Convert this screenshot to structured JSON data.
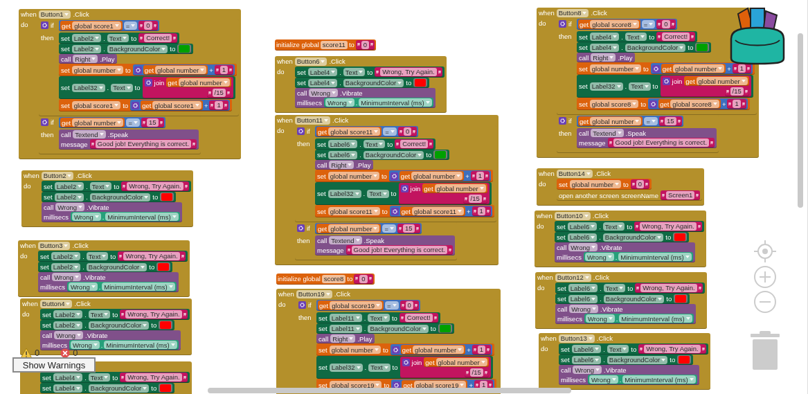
{
  "workspace": {
    "blocks": [
      {
        "kind": "event",
        "when": "when",
        "component": "Button1",
        "event": ".Click",
        "do": "do",
        "body": [
          {
            "kind": "if",
            "label": "if",
            "cond": {
              "kind": "compare",
              "left": {
                "kind": "get",
                "label": "get",
                "field": "global score1"
              },
              "op": "=",
              "right": {
                "kind": "text",
                "string": "0"
              }
            },
            "then": "then",
            "body": [
              {
                "kind": "set_prop",
                "label": "set",
                "component": "Label2",
                "dot": ".",
                "property": "Text",
                "to": "to",
                "value": {
                  "kind": "text",
                  "string": "Correct!"
                }
              },
              {
                "kind": "set_prop",
                "label": "set",
                "component": "Label2",
                "dot": ".",
                "property": "BackgroundColor",
                "to": "to",
                "value": {
                  "kind": "color",
                  "color": "#00a000"
                }
              },
              {
                "kind": "call",
                "label": "call",
                "component": "Right",
                "method": ".Play"
              },
              {
                "kind": "set_var",
                "label": "set",
                "field": "global number",
                "to": "to",
                "value": {
                  "kind": "add",
                  "left": {
                    "kind": "get",
                    "label": "get",
                    "field": "global number"
                  },
                  "op": "+",
                  "right": {
                    "kind": "text",
                    "string": "1"
                  }
                }
              },
              {
                "kind": "set_prop",
                "label": "set",
                "component": "Label32",
                "dot": ".",
                "property": "Text",
                "to": "to",
                "value": {
                  "kind": "join",
                  "label": "join",
                  "items": [
                    {
                      "kind": "get",
                      "label": "get",
                      "field": "global number"
                    },
                    {
                      "kind": "text",
                      "string": "/15"
                    }
                  ]
                }
              },
              {
                "kind": "set_var",
                "label": "set",
                "field": "global score1",
                "to": "to",
                "value": {
                  "kind": "add",
                  "left": {
                    "kind": "get",
                    "label": "get",
                    "field": "global score1"
                  },
                  "op": "+",
                  "right": {
                    "kind": "text",
                    "string": "1"
                  }
                }
              }
            ]
          },
          {
            "kind": "if",
            "label": "if",
            "cond": {
              "kind": "compare",
              "left": {
                "kind": "get",
                "label": "get",
                "field": "global number"
              },
              "op": "=",
              "right": {
                "kind": "text",
                "string": "15"
              }
            },
            "then": "then",
            "body": [
              {
                "kind": "call",
                "label": "call",
                "component": "Textend",
                "method": ".Speak",
                "args": [
                  {
                    "name": "message",
                    "value": {
                      "kind": "text",
                      "string": "Good job! Everything is correct."
                    }
                  }
                ]
              }
            ]
          }
        ]
      },
      {
        "kind": "event",
        "when": "when",
        "component": "Button2",
        "event": ".Click",
        "do": "do",
        "body": [
          {
            "kind": "set_prop",
            "label": "set",
            "component": "Label2",
            "dot": ".",
            "property": "Text",
            "to": "to",
            "value": {
              "kind": "text",
              "string": "Wrong, Try Again."
            }
          },
          {
            "kind": "set_prop",
            "label": "set",
            "component": "Label2",
            "dot": ".",
            "property": "BackgroundColor",
            "to": "to",
            "value": {
              "kind": "color",
              "color": "#ff0000"
            }
          },
          {
            "kind": "call",
            "label": "call",
            "component": "Wrong",
            "method": ".Vibrate",
            "args": [
              {
                "name": "millisecs",
                "value": {
                  "kind": "property",
                  "component": "Wrong",
                  "dot": ".",
                  "property": "MinimumInterval (ms)"
                }
              }
            ]
          }
        ]
      },
      {
        "kind": "event",
        "when": "when",
        "component": "Button3",
        "event": ".Click",
        "do": "do",
        "body": [
          {
            "kind": "set_prop",
            "label": "set",
            "component": "Label2",
            "dot": ".",
            "property": "Text",
            "to": "to",
            "value": {
              "kind": "text",
              "string": "Wrong, Try Again."
            }
          },
          {
            "kind": "set_prop",
            "label": "set",
            "component": "Label2",
            "dot": ".",
            "property": "BackgroundColor",
            "to": "to",
            "value": {
              "kind": "color",
              "color": "#ff0000"
            }
          },
          {
            "kind": "call",
            "label": "call",
            "component": "Wrong",
            "method": ".Vibrate",
            "args": [
              {
                "name": "millisecs",
                "value": {
                  "kind": "property",
                  "component": "Wrong",
                  "dot": ".",
                  "property": "MinimumInterval (ms)"
                }
              }
            ]
          }
        ]
      },
      {
        "kind": "event",
        "when": "when",
        "component": "Button4",
        "event": ".Click",
        "do": "do",
        "body": [
          {
            "kind": "set_prop",
            "label": "set",
            "component": "Label2",
            "dot": ".",
            "property": "Text",
            "to": "to",
            "value": {
              "kind": "text",
              "string": "Wrong, Try Again."
            }
          },
          {
            "kind": "set_prop",
            "label": "set",
            "component": "Label2",
            "dot": ".",
            "property": "BackgroundColor",
            "to": "to",
            "value": {
              "kind": "color",
              "color": "#ff0000"
            }
          },
          {
            "kind": "call",
            "label": "call",
            "component": "Wrong",
            "method": ".Vibrate",
            "args": [
              {
                "name": "millisecs",
                "value": {
                  "kind": "property",
                  "component": "Wrong",
                  "dot": ".",
                  "property": "MinimumInterval (ms)"
                }
              }
            ]
          }
        ]
      },
      {
        "kind": "event",
        "body": [
          {
            "kind": "set_prop",
            "label": "set",
            "component": "Label4",
            "dot": ".",
            "property": "Text",
            "to": "to",
            "value": {
              "kind": "text",
              "string": "Wrong, Try Again."
            }
          },
          {
            "kind": "set_prop",
            "label": "set",
            "component": "Label4",
            "dot": ".",
            "property": "BackgroundColor",
            "to": "to",
            "value": {
              "kind": "color",
              "color": "#ff0000"
            }
          }
        ]
      },
      {
        "kind": "init",
        "label": "initialize global",
        "name": "score11",
        "to": "to",
        "value": {
          "kind": "text",
          "string": "0"
        }
      },
      {
        "kind": "event",
        "when": "when",
        "component": "Button6",
        "event": ".Click",
        "do": "do",
        "body": [
          {
            "kind": "set_prop",
            "label": "set",
            "component": "Label4",
            "dot": ".",
            "property": "Text",
            "to": "to",
            "value": {
              "kind": "text",
              "string": "Wrong, Try Again."
            }
          },
          {
            "kind": "set_prop",
            "label": "set",
            "component": "Label4",
            "dot": ".",
            "property": "BackgroundColor",
            "to": "to",
            "value": {
              "kind": "color",
              "color": "#ff0000"
            }
          },
          {
            "kind": "call",
            "label": "call",
            "component": "Wrong",
            "method": ".Vibrate",
            "args": [
              {
                "name": "millisecs",
                "value": {
                  "kind": "property",
                  "component": "Wrong",
                  "dot": ".",
                  "property": "MinimumInterval (ms)"
                }
              }
            ]
          }
        ]
      },
      {
        "kind": "event",
        "when": "when",
        "component": "Button11",
        "event": ".Click",
        "do": "do",
        "body": [
          {
            "kind": "if",
            "label": "if",
            "cond": {
              "kind": "compare",
              "left": {
                "kind": "get",
                "label": "get",
                "field": "global score11"
              },
              "op": "=",
              "right": {
                "kind": "text",
                "string": "0"
              }
            },
            "then": "then",
            "body": [
              {
                "kind": "set_prop",
                "label": "set",
                "component": "Label6",
                "dot": ".",
                "property": "Text",
                "to": "to",
                "value": {
                  "kind": "text",
                  "string": "Correct!"
                }
              },
              {
                "kind": "set_prop",
                "label": "set",
                "component": "Label6",
                "dot": ".",
                "property": "BackgroundColor",
                "to": "to",
                "value": {
                  "kind": "color",
                  "color": "#00a000"
                }
              },
              {
                "kind": "call",
                "label": "call",
                "component": "Right",
                "method": ".Play"
              },
              {
                "kind": "set_var",
                "label": "set",
                "field": "global number",
                "to": "to",
                "value": {
                  "kind": "add",
                  "left": {
                    "kind": "get",
                    "label": "get",
                    "field": "global number"
                  },
                  "op": "+",
                  "right": {
                    "kind": "text",
                    "string": "1"
                  }
                }
              },
              {
                "kind": "set_prop",
                "label": "set",
                "component": "Label32",
                "dot": ".",
                "property": "Text",
                "to": "to",
                "value": {
                  "kind": "join",
                  "label": "join",
                  "items": [
                    {
                      "kind": "get",
                      "label": "get",
                      "field": "global number"
                    },
                    {
                      "kind": "text",
                      "string": "/15"
                    }
                  ]
                }
              },
              {
                "kind": "set_var",
                "label": "set",
                "field": "global score11",
                "to": "to",
                "value": {
                  "kind": "add",
                  "left": {
                    "kind": "get",
                    "label": "get",
                    "field": "global score11"
                  },
                  "op": "+",
                  "right": {
                    "kind": "text",
                    "string": "1"
                  }
                }
              }
            ]
          },
          {
            "kind": "if",
            "label": "if",
            "cond": {
              "kind": "compare",
              "left": {
                "kind": "get",
                "label": "get",
                "field": "global number"
              },
              "op": "=",
              "right": {
                "kind": "text",
                "string": "15"
              }
            },
            "then": "then",
            "body": [
              {
                "kind": "call",
                "label": "call",
                "component": "Textend",
                "method": ".Speak",
                "args": [
                  {
                    "name": "message",
                    "value": {
                      "kind": "text",
                      "string": "Good job! Everything is correct."
                    }
                  }
                ]
              }
            ]
          }
        ]
      },
      {
        "kind": "init",
        "label": "initialize global",
        "name": "score8",
        "to": "to",
        "value": {
          "kind": "text",
          "string": "0"
        }
      },
      {
        "kind": "event",
        "when": "when",
        "component": "Button19",
        "event": ".Click",
        "do": "do",
        "body": [
          {
            "kind": "if",
            "label": "if",
            "cond": {
              "kind": "compare",
              "left": {
                "kind": "get",
                "label": "get",
                "field": "global score19"
              },
              "op": "=",
              "right": {
                "kind": "text",
                "string": "0"
              }
            },
            "then": "then",
            "body": [
              {
                "kind": "set_prop",
                "label": "set",
                "component": "Label11",
                "dot": ".",
                "property": "Text",
                "to": "to",
                "value": {
                  "kind": "text",
                  "string": "Correct!"
                }
              },
              {
                "kind": "set_prop",
                "label": "set",
                "component": "Label11",
                "dot": ".",
                "property": "BackgroundColor",
                "to": "to",
                "value": {
                  "kind": "color",
                  "color": "#00a000"
                }
              },
              {
                "kind": "call",
                "label": "call",
                "component": "Right",
                "method": ".Play"
              },
              {
                "kind": "set_var",
                "label": "set",
                "field": "global number",
                "to": "to",
                "value": {
                  "kind": "add",
                  "left": {
                    "kind": "get",
                    "label": "get",
                    "field": "global number"
                  },
                  "op": "+",
                  "right": {
                    "kind": "text",
                    "string": "1"
                  }
                }
              },
              {
                "kind": "set_prop",
                "label": "set",
                "component": "Label32",
                "dot": ".",
                "property": "Text",
                "to": "to",
                "value": {
                  "kind": "join",
                  "label": "join",
                  "items": [
                    {
                      "kind": "get",
                      "label": "get",
                      "field": "global number"
                    },
                    {
                      "kind": "text",
                      "string": "/15"
                    }
                  ]
                }
              },
              {
                "kind": "set_var",
                "label": "set",
                "field": "global score19",
                "to": "to",
                "value": {
                  "kind": "add",
                  "left": {
                    "kind": "get",
                    "label": "get",
                    "field": "global score19"
                  },
                  "op": "+",
                  "right": {
                    "kind": "text",
                    "string": "1"
                  }
                }
              }
            ]
          }
        ]
      },
      {
        "kind": "event",
        "when": "when",
        "component": "Button8",
        "event": ".Click",
        "do": "do",
        "body": [
          {
            "kind": "if",
            "label": "if",
            "cond": {
              "kind": "compare",
              "left": {
                "kind": "get",
                "label": "get",
                "field": "global score8"
              },
              "op": "=",
              "right": {
                "kind": "text",
                "string": "0"
              }
            },
            "then": "then",
            "body": [
              {
                "kind": "set_prop",
                "label": "set",
                "component": "Label4",
                "dot": ".",
                "property": "Text",
                "to": "to",
                "value": {
                  "kind": "text",
                  "string": "Correct!"
                }
              },
              {
                "kind": "set_prop",
                "label": "set",
                "component": "Label4",
                "dot": ".",
                "property": "BackgroundColor",
                "to": "to",
                "value": {
                  "kind": "color",
                  "color": "#00a000"
                }
              },
              {
                "kind": "call",
                "label": "call",
                "component": "Right",
                "method": ".Play"
              },
              {
                "kind": "set_var",
                "label": "set",
                "field": "global number",
                "to": "to",
                "value": {
                  "kind": "add",
                  "left": {
                    "kind": "get",
                    "label": "get",
                    "field": "global number"
                  },
                  "op": "+",
                  "right": {
                    "kind": "text",
                    "string": "1"
                  }
                }
              },
              {
                "kind": "set_prop",
                "label": "set",
                "component": "Label32",
                "dot": ".",
                "property": "Text",
                "to": "to",
                "value": {
                  "kind": "join",
                  "label": "join",
                  "items": [
                    {
                      "kind": "get",
                      "label": "get",
                      "field": "global number"
                    },
                    {
                      "kind": "text",
                      "string": "/15"
                    }
                  ]
                }
              },
              {
                "kind": "set_var",
                "label": "set",
                "field": "global score8",
                "to": "to",
                "value": {
                  "kind": "add",
                  "left": {
                    "kind": "get",
                    "label": "get",
                    "field": "global score8"
                  },
                  "op": "+",
                  "right": {
                    "kind": "text",
                    "string": "1"
                  }
                }
              }
            ]
          },
          {
            "kind": "if",
            "label": "if",
            "cond": {
              "kind": "compare",
              "left": {
                "kind": "get",
                "label": "get",
                "field": "global number"
              },
              "op": "=",
              "right": {
                "kind": "text",
                "string": "15"
              }
            },
            "then": "then",
            "body": [
              {
                "kind": "call",
                "label": "call",
                "component": "Textend",
                "method": ".Speak",
                "args": [
                  {
                    "name": "message",
                    "value": {
                      "kind": "text",
                      "string": "Good job! Everything is correct."
                    }
                  }
                ]
              }
            ]
          }
        ]
      },
      {
        "kind": "event",
        "when": "when",
        "component": "Button14",
        "event": ".Click",
        "do": "do",
        "body": [
          {
            "kind": "set_var",
            "label": "set",
            "field": "global number",
            "to": "to",
            "value": {
              "kind": "text",
              "string": "0"
            }
          },
          {
            "kind": "open_screen",
            "label": "open another screen",
            "arg": "screenName",
            "value": {
              "kind": "text",
              "string": "Screen1"
            }
          }
        ]
      },
      {
        "kind": "event",
        "when": "when",
        "component": "Button10",
        "event": ".Click",
        "do": "do",
        "body": [
          {
            "kind": "set_prop",
            "label": "set",
            "component": "Label6",
            "dot": ".",
            "property": "Text",
            "to": "to",
            "value": {
              "kind": "text",
              "string": "Wrong, Try Again."
            }
          },
          {
            "kind": "set_prop",
            "label": "set",
            "component": "Label6",
            "dot": ".",
            "property": "BackgroundColor",
            "to": "to",
            "value": {
              "kind": "color",
              "color": "#ff0000"
            }
          },
          {
            "kind": "call",
            "label": "call",
            "component": "Wrong",
            "method": ".Vibrate",
            "args": [
              {
                "name": "millisecs",
                "value": {
                  "kind": "property",
                  "component": "Wrong",
                  "dot": ".",
                  "property": "MinimumInterval (ms)"
                }
              }
            ]
          }
        ]
      },
      {
        "kind": "event",
        "when": "when",
        "component": "Button12",
        "event": ".Click",
        "do": "do",
        "body": [
          {
            "kind": "set_prop",
            "label": "set",
            "component": "Label6",
            "dot": ".",
            "property": "Text",
            "to": "to",
            "value": {
              "kind": "text",
              "string": "Wrong, Try Again."
            }
          },
          {
            "kind": "set_prop",
            "label": "set",
            "component": "Label6",
            "dot": ".",
            "property": "BackgroundColor",
            "to": "to",
            "value": {
              "kind": "color",
              "color": "#ff0000"
            }
          },
          {
            "kind": "call",
            "label": "call",
            "component": "Wrong",
            "method": ".Vibrate",
            "args": [
              {
                "name": "millisecs",
                "value": {
                  "kind": "property",
                  "component": "Wrong",
                  "dot": ".",
                  "property": "MinimumInterval (ms)"
                }
              }
            ]
          }
        ]
      },
      {
        "kind": "event",
        "when": "when",
        "component": "Button13",
        "event": ".Click",
        "do": "do",
        "body": [
          {
            "kind": "set_prop",
            "label": "set",
            "component": "Label6",
            "dot": ".",
            "property": "Text",
            "to": "to",
            "value": {
              "kind": "text",
              "string": "Wrong, Try Again."
            }
          },
          {
            "kind": "set_prop",
            "label": "set",
            "component": "Label6",
            "dot": ".",
            "property": "BackgroundColor",
            "to": "to",
            "value": {
              "kind": "color",
              "color": "#ff0000"
            }
          },
          {
            "kind": "call",
            "label": "call",
            "component": "Wrong",
            "method": ".Vibrate",
            "args": [
              {
                "name": "millisecs",
                "value": {
                  "kind": "property",
                  "component": "Wrong",
                  "dot": ".",
                  "property": "MinimumInterval (ms)"
                }
              }
            ]
          }
        ]
      }
    ]
  },
  "warnings": {
    "warning_count": "0",
    "error_count": "0",
    "button": "Show Warnings"
  }
}
